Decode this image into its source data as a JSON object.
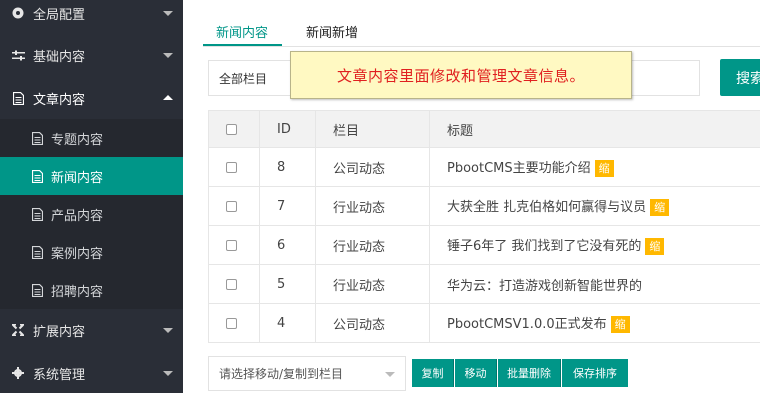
{
  "sidebar": {
    "groups": [
      {
        "label": "全局配置",
        "icon": "gear-circle-icon"
      },
      {
        "label": "基础内容",
        "icon": "sliders-icon"
      },
      {
        "label": "文章内容",
        "icon": "document-icon"
      },
      {
        "label": "扩展内容",
        "icon": "expand-icon"
      },
      {
        "label": "系统管理",
        "icon": "gear-icon"
      }
    ],
    "items": [
      {
        "label": "专题内容",
        "icon": "document-icon",
        "active": false
      },
      {
        "label": "新闻内容",
        "icon": "document-icon",
        "active": true
      },
      {
        "label": "产品内容",
        "icon": "document-icon",
        "active": false
      },
      {
        "label": "案例内容",
        "icon": "document-icon",
        "active": false
      },
      {
        "label": "招聘内容",
        "icon": "document-icon",
        "active": false
      }
    ]
  },
  "tabs": [
    "新闻内容",
    "新闻新增"
  ],
  "filter": {
    "category_select": "全部栏目",
    "search_label": "搜索"
  },
  "tooltip": "文章内容里面修改和管理文章信息。",
  "table": {
    "headers": [
      "ID",
      "栏目",
      "标题"
    ],
    "rows": [
      {
        "id": "8",
        "category": "公司动态",
        "title": "PbootCMS主要功能介绍",
        "tag": "缩"
      },
      {
        "id": "7",
        "category": "行业动态",
        "title": "大获全胜 扎克伯格如何赢得与议员",
        "tag": "缩"
      },
      {
        "id": "6",
        "category": "行业动态",
        "title": "锤子6年了 我们找到了它没有死的",
        "tag": "缩"
      },
      {
        "id": "5",
        "category": "行业动态",
        "title": "华为云：打造游戏创新智能世界的",
        "tag": ""
      },
      {
        "id": "4",
        "category": "公司动态",
        "title": "PbootCMSV1.0.0正式发布",
        "tag": "缩"
      }
    ]
  },
  "bottom": {
    "move_select": "请选择移动/复制到栏目",
    "buttons": [
      "复制",
      "移动",
      "批量删除",
      "保存排序"
    ]
  },
  "colors": {
    "accent": "#009688",
    "sidebar_bg": "#2a2e37",
    "tag": "#ffb800",
    "tooltip_bg": "#fff9c2",
    "tooltip_text": "#e02020"
  }
}
